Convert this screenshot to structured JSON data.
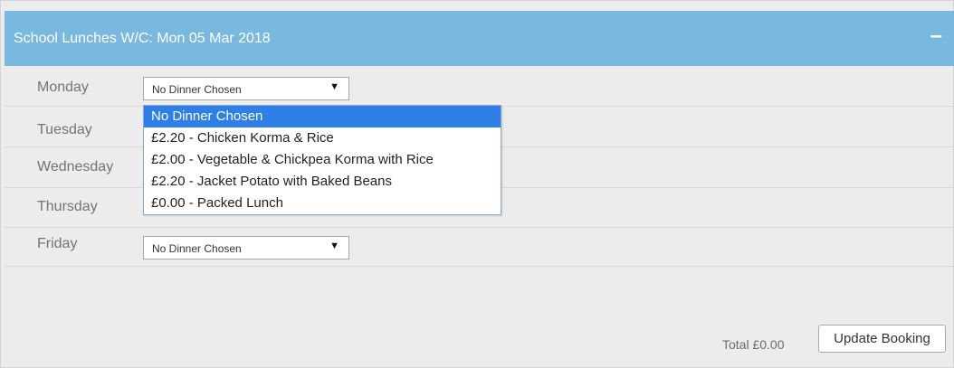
{
  "panel": {
    "title": "School Lunches W/C: Mon 05 Mar 2018",
    "collapse_symbol": "–",
    "header_color": "#79b8df"
  },
  "days": [
    {
      "label": "Monday",
      "selected": "No Dinner Chosen"
    },
    {
      "label": "Tuesday"
    },
    {
      "label": "Wednesday"
    },
    {
      "label": "Thursday"
    },
    {
      "label": "Friday",
      "selected": "No Dinner Chosen"
    }
  ],
  "select_arrow": "▼",
  "dropdown": {
    "options": [
      "No Dinner Chosen",
      "£2.20 - Chicken Korma & Rice",
      "£2.00 - Vegetable & Chickpea Korma with Rice",
      "£2.20 - Jacket Potato with Baked Beans",
      "£0.00 - Packed Lunch"
    ],
    "highlight_color": "#2f7fe8"
  },
  "footer": {
    "total": "Total £0.00",
    "update_button": "Update Booking"
  }
}
